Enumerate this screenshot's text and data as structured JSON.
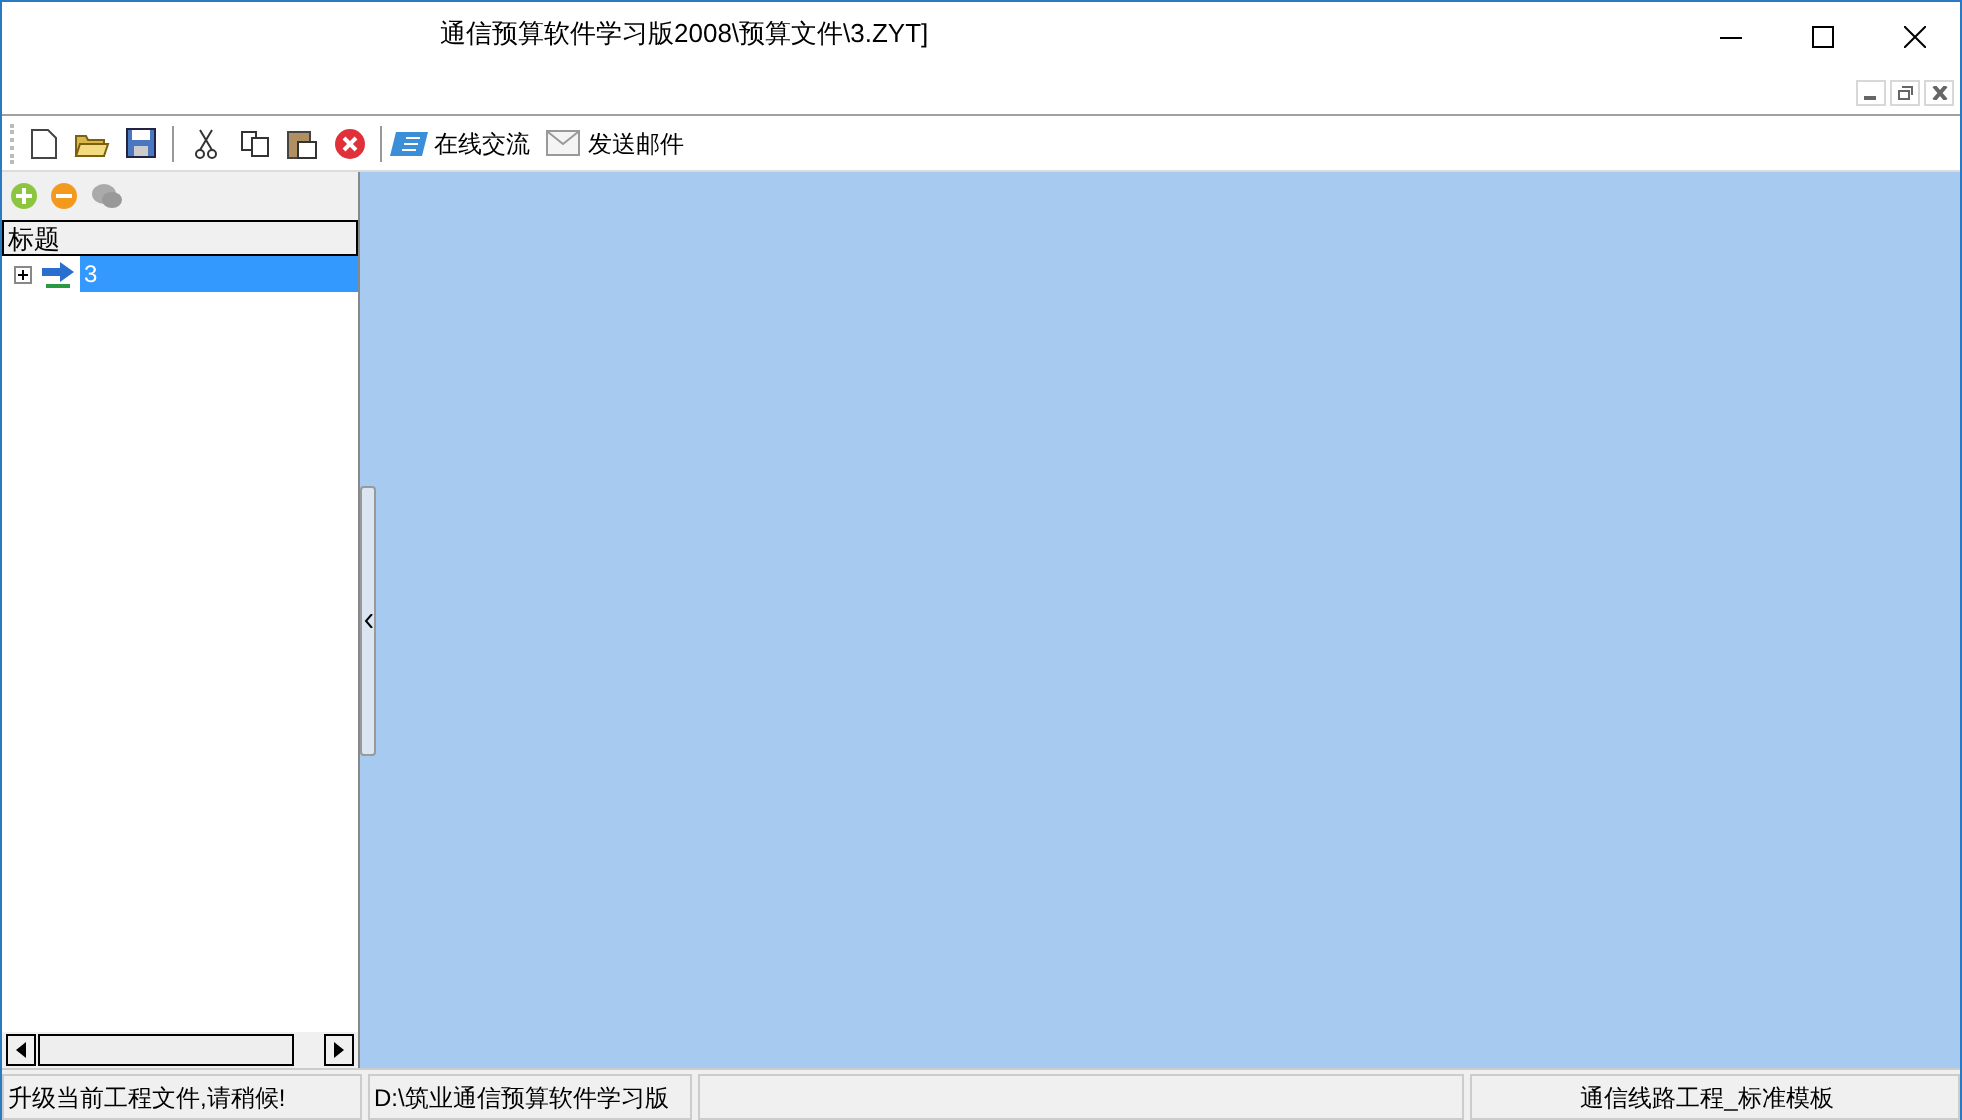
{
  "window": {
    "title": "通信预算软件学习版2008\\预算文件\\3.ZYT]"
  },
  "toolbar": {
    "buttons": [
      {
        "label": "在线交流"
      },
      {
        "label": "发送邮件"
      }
    ]
  },
  "tree": {
    "header": "标题",
    "items": [
      {
        "label": "3",
        "selected": true,
        "expanded": false
      }
    ]
  },
  "status_bar": [
    "升级当前工程文件,请稍候!",
    "D:\\筑业通信预算软件学习版",
    "通信线路工程_标准模板"
  ]
}
